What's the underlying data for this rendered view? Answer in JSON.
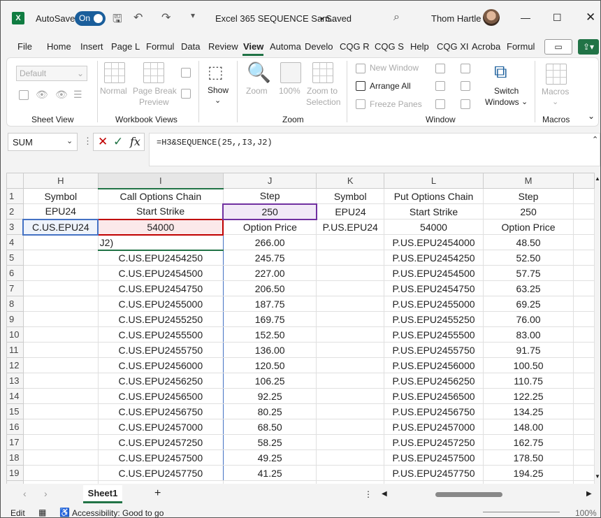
{
  "titlebar": {
    "autosave_label": "AutoSave",
    "toggle": "On",
    "document_title": "Excel 365 SEQUENCE Sam...",
    "saved": "• Saved",
    "user_name": "Thom Hartle"
  },
  "menu": [
    "File",
    "Home",
    "Insert",
    "Page L",
    "Formul",
    "Data",
    "Review",
    "View",
    "Automa",
    "Develo",
    "CQG R",
    "CQG S",
    "Help",
    "CQG XI",
    "Acroba",
    "Formul"
  ],
  "ribbon": {
    "sheet_view": {
      "select_value": "Default",
      "group_label": "Sheet View"
    },
    "workbook_views": {
      "normal": "Normal",
      "page_break": "Page Break",
      "preview": "Preview",
      "group_label": "Workbook Views"
    },
    "show": {
      "label": "Show"
    },
    "zoom": {
      "zoom": "Zoom",
      "percent": "100%",
      "zoom_to": "Zoom to",
      "selection": "Selection",
      "group_label": "Zoom"
    },
    "window": {
      "new_window": "New Window",
      "arrange_all": "Arrange All",
      "freeze_panes": "Freeze Panes",
      "switch": "Switch",
      "windows": "Windows",
      "group_label": "Window"
    },
    "macros": {
      "label": "Macros",
      "group_label": "Macros"
    }
  },
  "formula_bar": {
    "name_box": "SUM",
    "formula": "=H3&SEQUENCE(25,,I3,J2)"
  },
  "columns": [
    "H",
    "I",
    "J",
    "K",
    "L",
    "M"
  ],
  "rows": [
    {
      "n": "1",
      "H": "Symbol",
      "I": "Call Options Chain",
      "J": "Step",
      "K": "Symbol",
      "L": "Put Options Chain",
      "M": "Step"
    },
    {
      "n": "2",
      "H": "EPU24",
      "I": "Start Strike",
      "J": "250",
      "K": "EPU24",
      "L": "Start Strike",
      "M": "250"
    },
    {
      "n": "3",
      "H": "C.US.EPU24",
      "I": "54000",
      "J": "Option Price",
      "K": "P.US.EPU24",
      "L": "54000",
      "M": "Option Price"
    },
    {
      "n": "4",
      "H": "",
      "I": "J2)",
      "J": "266.00",
      "K": "",
      "L": "P.US.EPU2454000",
      "M": "48.50"
    },
    {
      "n": "5",
      "H": "",
      "I": "C.US.EPU2454250",
      "J": "245.75",
      "K": "",
      "L": "P.US.EPU2454250",
      "M": "52.50"
    },
    {
      "n": "6",
      "H": "",
      "I": "C.US.EPU2454500",
      "J": "227.00",
      "K": "",
      "L": "P.US.EPU2454500",
      "M": "57.75"
    },
    {
      "n": "7",
      "H": "",
      "I": "C.US.EPU2454750",
      "J": "206.50",
      "K": "",
      "L": "P.US.EPU2454750",
      "M": "63.25"
    },
    {
      "n": "8",
      "H": "",
      "I": "C.US.EPU2455000",
      "J": "187.75",
      "K": "",
      "L": "P.US.EPU2455000",
      "M": "69.25"
    },
    {
      "n": "9",
      "H": "",
      "I": "C.US.EPU2455250",
      "J": "169.75",
      "K": "",
      "L": "P.US.EPU2455250",
      "M": "76.00"
    },
    {
      "n": "10",
      "H": "",
      "I": "C.US.EPU2455500",
      "J": "152.50",
      "K": "",
      "L": "P.US.EPU2455500",
      "M": "83.00"
    },
    {
      "n": "11",
      "H": "",
      "I": "C.US.EPU2455750",
      "J": "136.00",
      "K": "",
      "L": "P.US.EPU2455750",
      "M": "91.75"
    },
    {
      "n": "12",
      "H": "",
      "I": "C.US.EPU2456000",
      "J": "120.50",
      "K": "",
      "L": "P.US.EPU2456000",
      "M": "100.50"
    },
    {
      "n": "13",
      "H": "",
      "I": "C.US.EPU2456250",
      "J": "106.25",
      "K": "",
      "L": "P.US.EPU2456250",
      "M": "110.75"
    },
    {
      "n": "14",
      "H": "",
      "I": "C.US.EPU2456500",
      "J": "92.25",
      "K": "",
      "L": "P.US.EPU2456500",
      "M": "122.25"
    },
    {
      "n": "15",
      "H": "",
      "I": "C.US.EPU2456750",
      "J": "80.25",
      "K": "",
      "L": "P.US.EPU2456750",
      "M": "134.25"
    },
    {
      "n": "16",
      "H": "",
      "I": "C.US.EPU2457000",
      "J": "68.50",
      "K": "",
      "L": "P.US.EPU2457000",
      "M": "148.00"
    },
    {
      "n": "17",
      "H": "",
      "I": "C.US.EPU2457250",
      "J": "58.25",
      "K": "",
      "L": "P.US.EPU2457250",
      "M": "162.75"
    },
    {
      "n": "18",
      "H": "",
      "I": "C.US.EPU2457500",
      "J": "49.25",
      "K": "",
      "L": "P.US.EPU2457500",
      "M": "178.50"
    },
    {
      "n": "19",
      "H": "",
      "I": "C.US.EPU2457750",
      "J": "41.25",
      "K": "",
      "L": "P.US.EPU2457750",
      "M": "194.25"
    }
  ],
  "sheet_tab": "Sheet1",
  "status": {
    "mode": "Edit",
    "accessibility": "Accessibility: Good to go",
    "zoom": "100%"
  },
  "colors": {
    "accent": "#217346",
    "ref_h3": "#4472c4",
    "ref_i3": "#c00000",
    "ref_j2": "#7030a0"
  }
}
